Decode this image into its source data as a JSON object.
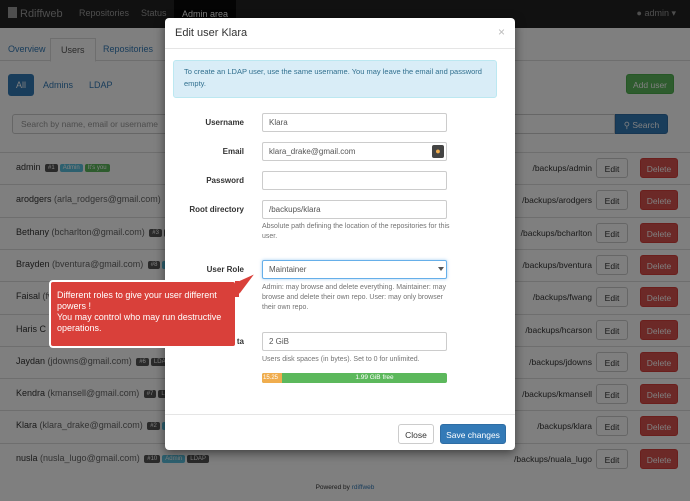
{
  "navbar": {
    "brand": "Rdiffweb",
    "links": [
      "Repositories",
      "Status"
    ],
    "active_link": "Admin area",
    "user": "admin"
  },
  "subtabs": {
    "items": [
      "Overview",
      "Users",
      "Repositories"
    ],
    "active_index": 1
  },
  "filters": {
    "all": "All",
    "admins": "Admins",
    "ldap": "LDAP"
  },
  "add_user_label": "Add user",
  "search": {
    "placeholder": "Search by name, email or username",
    "button": "Search"
  },
  "row_buttons": {
    "edit": "Edit",
    "delete": "Delete"
  },
  "users": [
    {
      "name": "admin",
      "email": "",
      "id": "#1",
      "badges": [
        "Admin",
        "It's you"
      ],
      "path": "/backups/admin"
    },
    {
      "name": "arodgers",
      "email": "(arla_rodgers@gmail.com)",
      "id": "#5",
      "badges": [],
      "path": "/backups/arodgers"
    },
    {
      "name": "Bethany",
      "email": "(bcharlton@gmail.com)",
      "id": "#3",
      "badges": [
        "LDAP"
      ],
      "path": "/backups/bcharlton"
    },
    {
      "name": "Brayden",
      "email": "(bventura@gmail.com)",
      "id": "#8",
      "badges": [
        "Admin"
      ],
      "path": "/backups/bventura"
    },
    {
      "name": "Faisal",
      "email": "(fw",
      "id": "",
      "badges": [],
      "path": "/backups/fwang"
    },
    {
      "name": "Haris C",
      "email": "",
      "id": "",
      "badges": [],
      "path": "/backups/hcarson"
    },
    {
      "name": "Jaydan",
      "email": "(jdowns@gmail.com)",
      "id": "#6",
      "badges": [
        "LDAP"
      ],
      "path": "/backups/jdowns"
    },
    {
      "name": "Kendra",
      "email": "(kmansell@gmail.com)",
      "id": "#7",
      "badges": [
        "LDAP"
      ],
      "path": "/backups/kmansell"
    },
    {
      "name": "Klara",
      "email": "(klara_drake@gmail.com)",
      "id": "#2",
      "badges": [
        "Admin"
      ],
      "path": "/backups/klara"
    },
    {
      "name": "nusla",
      "email": "(nusla_lugo@gmail.com)",
      "id": "#10",
      "badges": [
        "Admin",
        "LDAP"
      ],
      "path": "/backups/nuala_lugo"
    }
  ],
  "footer": {
    "prefix": "Powered by",
    "link": "rdiffweb"
  },
  "modal": {
    "title": "Edit user Klara",
    "close_symbol": "×",
    "info": "To create an LDAP user, use the same username. You may leave the email and password empty.",
    "fields": {
      "username": {
        "label": "Username",
        "value": "Klara"
      },
      "email": {
        "label": "Email",
        "value": "klara_drake@gmail.com"
      },
      "password": {
        "label": "Password",
        "value": ""
      },
      "root": {
        "label": "Root directory",
        "value": "/backups/klara",
        "help": "Absolute path defining the location of the repositories for this user."
      },
      "role": {
        "label": "User Role",
        "value": "Maintainer",
        "help": "Admin: may browse and delete everything. Maintainer: may browse and delete their own repo. User: may only browser their own repo."
      },
      "quota": {
        "label": "User Quota",
        "value": "2 GiB",
        "help": "Users disk spaces (in bytes). Set to 0 for unlimited."
      }
    },
    "quota_bar": {
      "used_label": "15.25",
      "free_label": "1.99 GiB free",
      "used_fraction": 0.1
    },
    "buttons": {
      "close": "Close",
      "save": "Save changes"
    }
  },
  "callout": {
    "line1": "Different roles to give your user different powers !",
    "line2": "You may control who may run destructive operations."
  },
  "colors": {
    "primary": "#337ab7",
    "danger": "#d9534f",
    "success": "#5cb85c",
    "callout": "#d9403a"
  }
}
